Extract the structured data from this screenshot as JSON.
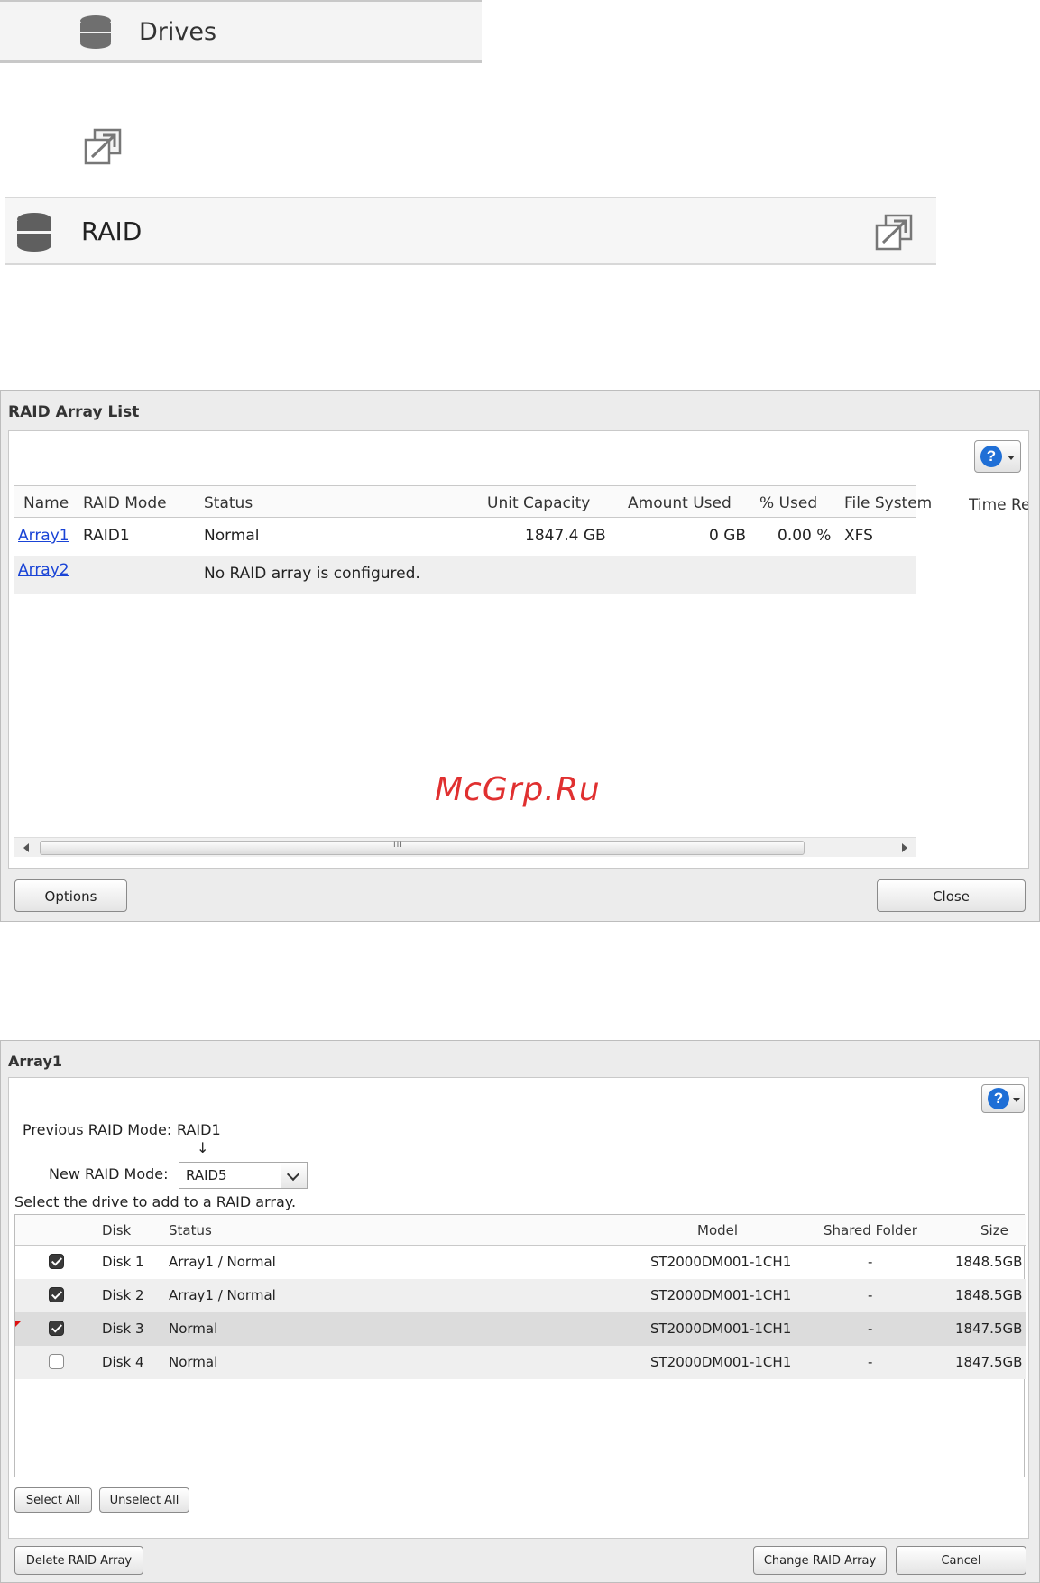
{
  "drives_bar": {
    "label": "Drives",
    "icon": "database-icon"
  },
  "standalone_icon": "expand-icon",
  "raid_bar": {
    "label": "RAID",
    "icon": "database-icon",
    "expand_icon": "expand-icon"
  },
  "raid_array_list": {
    "title": "RAID Array List",
    "help_icon": "help-icon",
    "columns": [
      "Name",
      "RAID Mode",
      "Status",
      "Unit Capacity",
      "Amount Used",
      "% Used",
      "File System",
      "Time Re"
    ],
    "rows": [
      {
        "name": "Array1",
        "raid_mode": "RAID1",
        "status": "Normal",
        "unit_capacity": "1847.4 GB",
        "amount_used": "0 GB",
        "pct_used": "0.00 %",
        "file_system": "XFS"
      },
      {
        "name": "Array2",
        "raid_mode": "",
        "status": "No RAID array is configured.",
        "unit_capacity": "",
        "amount_used": "",
        "pct_used": "",
        "file_system": ""
      }
    ],
    "scroll_grip": "III",
    "buttons": {
      "options": "Options",
      "close": "Close"
    }
  },
  "watermark": "McGrp.Ru",
  "array1_dialog": {
    "title": "Array1",
    "previous_mode_label": "Previous RAID Mode:",
    "previous_mode_value": "RAID1",
    "arrow": "↓",
    "new_mode_label": "New RAID Mode:",
    "new_mode_value": "RAID5",
    "instruction": "Select the drive to add to a RAID array.",
    "columns": [
      "Disk",
      "Status",
      "Model",
      "Shared Folder",
      "Size"
    ],
    "disks": [
      {
        "checked": true,
        "disk": "Disk 1",
        "status": "Array1 / Normal",
        "model": "ST2000DM001-1CH1",
        "shared_folder": "-",
        "size": "1848.5GB"
      },
      {
        "checked": true,
        "disk": "Disk 2",
        "status": "Array1 / Normal",
        "model": "ST2000DM001-1CH1",
        "shared_folder": "-",
        "size": "1848.5GB"
      },
      {
        "checked": true,
        "disk": "Disk 3",
        "status": "Normal",
        "model": "ST2000DM001-1CH1",
        "shared_folder": "-",
        "size": "1847.5GB"
      },
      {
        "checked": false,
        "disk": "Disk 4",
        "status": "Normal",
        "model": "ST2000DM001-1CH1",
        "shared_folder": "-",
        "size": "1847.5GB"
      }
    ],
    "buttons": {
      "select_all": "Select All",
      "unselect_all": "Unselect All",
      "delete_raid": "Delete RAID Array",
      "change_raid": "Change RAID Array",
      "cancel": "Cancel"
    }
  }
}
